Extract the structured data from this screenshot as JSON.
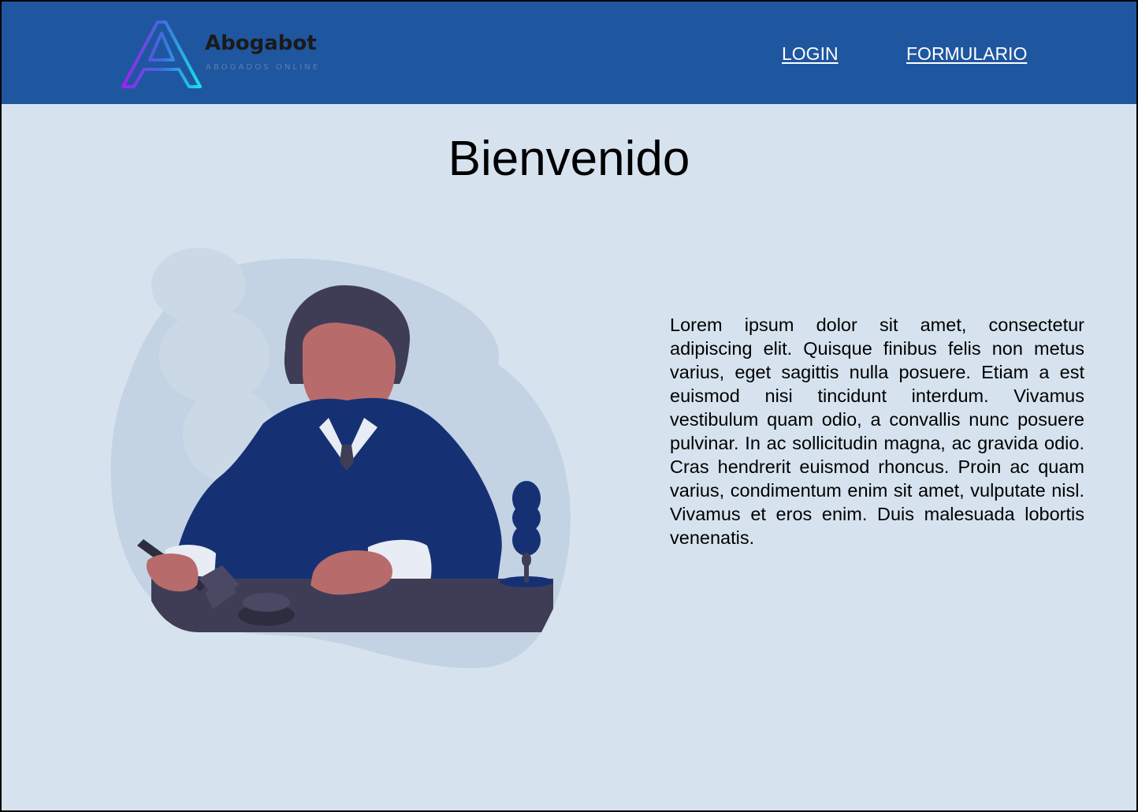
{
  "header": {
    "brand_name": "Abogabot",
    "brand_tagline": "ABOGADOS ONLINE",
    "nav": {
      "login_label": "LOGIN",
      "form_label": "FORMULARIO"
    }
  },
  "main": {
    "title": "Bienvenido",
    "paragraph": "Lorem ipsum dolor sit amet, consectetur adipiscing elit. Quisque finibus felis non metus varius, eget sagittis nulla posuere. Etiam a est euismod nisi tincidunt interdum. Vivamus vestibulum quam odio, a convallis nunc posuere pulvinar. In ac sollicitudin magna, ac gravida odio. Cras hendrerit euismod rhoncus. Proin ac quam varius, condimentum enim sit amet, vulputate nisl. Vivamus et eros enim. Duis malesuada lobortis venenatis."
  },
  "colors": {
    "header_bg": "#1f56a0",
    "page_bg": "#d6e3ef",
    "robe": "#163173",
    "desk": "#3f3d56",
    "skin": "#b86b6b"
  },
  "icons": {
    "logo": "a-logo-icon",
    "illustration": "judge-illustration"
  }
}
